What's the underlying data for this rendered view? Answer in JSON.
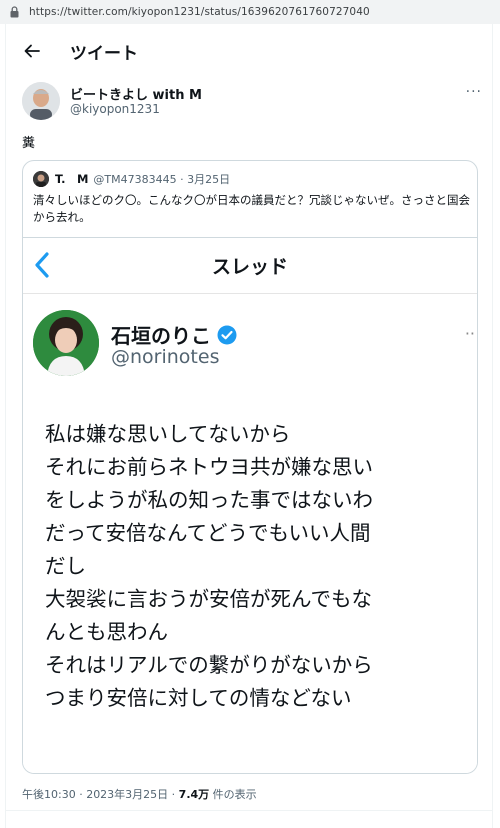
{
  "browser": {
    "url": "https://twitter.com/kiyopon1231/status/1639620761760727040"
  },
  "header": {
    "title": "ツイート"
  },
  "tweet": {
    "author_name": "ビートきよし with M",
    "author_handle": "@kiyopon1231",
    "text": "糞",
    "more_icon": "more-horizontal-icon"
  },
  "quote": {
    "author_name": "T.　M",
    "author_meta": "@TM47383445 · 3月25日",
    "text": "清々しいほどのク〇。こんなク〇が日本の議員だと？冗談じゃないぜ。さっさと国会から去れ。",
    "screenshot": {
      "nav_title": "スレッド",
      "profile_name": "石垣のりこ",
      "profile_handle": "@norinotes",
      "lines": [
        "私は嫌な思いしてないから",
        "それにお前らネトウヨ共が嫌な思い",
        "をしようが私の知った事ではないわ",
        "だって安倍なんてどうでもいい人間",
        "だし",
        "大袈裟に言おうが安倍が死んでもな",
        "んとも思わん",
        "それはリアルでの繋がりがないから",
        "つまり安倍に対しての情などない"
      ]
    }
  },
  "footer": {
    "time": "午後10:30 · 2023年3月25日 · ",
    "views_count": "7.4万",
    "views_label": " 件の表示"
  },
  "colors": {
    "accent": "#1d9bf0",
    "secondary_text": "#536471",
    "border": "#cfd9de"
  }
}
